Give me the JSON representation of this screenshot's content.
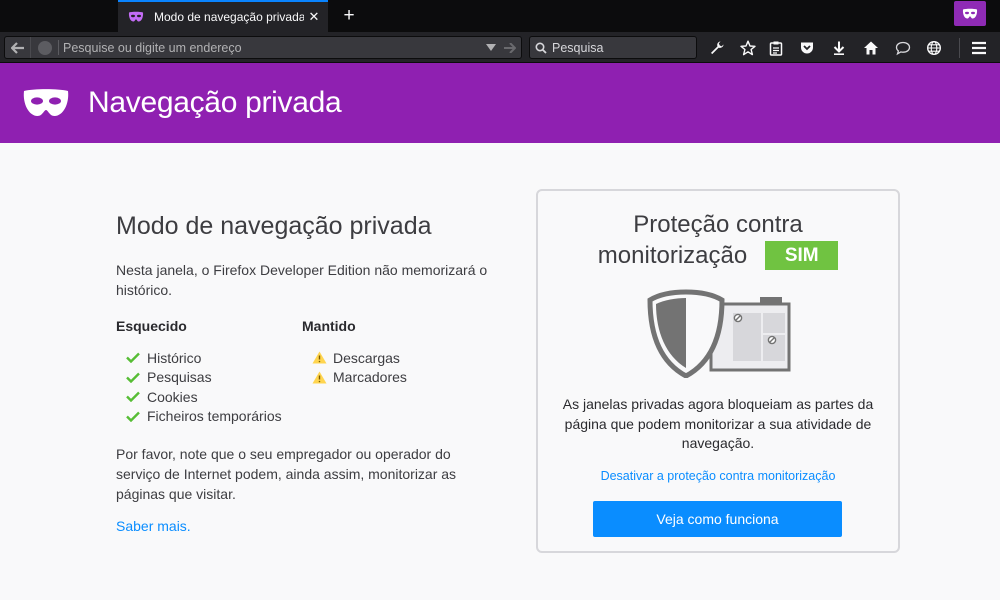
{
  "browser": {
    "tab_title": "Modo de navegação privada",
    "urlbar_placeholder": "Pesquise ou digite um endereço",
    "searchbar_placeholder": "Pesquisa"
  },
  "header": {
    "title": "Navegação privada"
  },
  "left": {
    "heading": "Modo de navegação privada",
    "intro": "Nesta janela, o Firefox Developer Edition não memorizará o histórico.",
    "forgotten_heading": "Esquecido",
    "forgotten_items": [
      "Histórico",
      "Pesquisas",
      "Cookies",
      "Ficheiros temporários"
    ],
    "kept_heading": "Mantido",
    "kept_items": [
      "Descargas",
      "Marcadores"
    ],
    "note": "Por favor, note que o seu empregador ou operador do serviço de Internet podem, ainda assim, monitorizar as páginas que visitar.",
    "learn_more": "Saber mais."
  },
  "card": {
    "title_line1": "Proteção contra",
    "title_line2": "monitorização",
    "status_badge": "SIM",
    "description": "As janelas privadas agora bloqueiam as partes da página que podem monitorizar a sua atividade de navegação.",
    "disable_link": "Desativar a proteção contra monitorização",
    "button_label": "Veja como funciona"
  },
  "colors": {
    "private_purple": "#8f20b1",
    "link_blue": "#0a8dff",
    "status_green": "#70c341",
    "check_green": "#57bd35",
    "warning_yellow": "#ffd54f"
  },
  "icons": {
    "tab_favicon": "private-mask-icon",
    "toolbar": [
      "wrench-icon",
      "star-icon",
      "clipboard-icon",
      "pocket-icon",
      "download-icon",
      "home-icon",
      "chat-bubble-icon",
      "globe-icon",
      "hamburger-menu-icon"
    ]
  }
}
